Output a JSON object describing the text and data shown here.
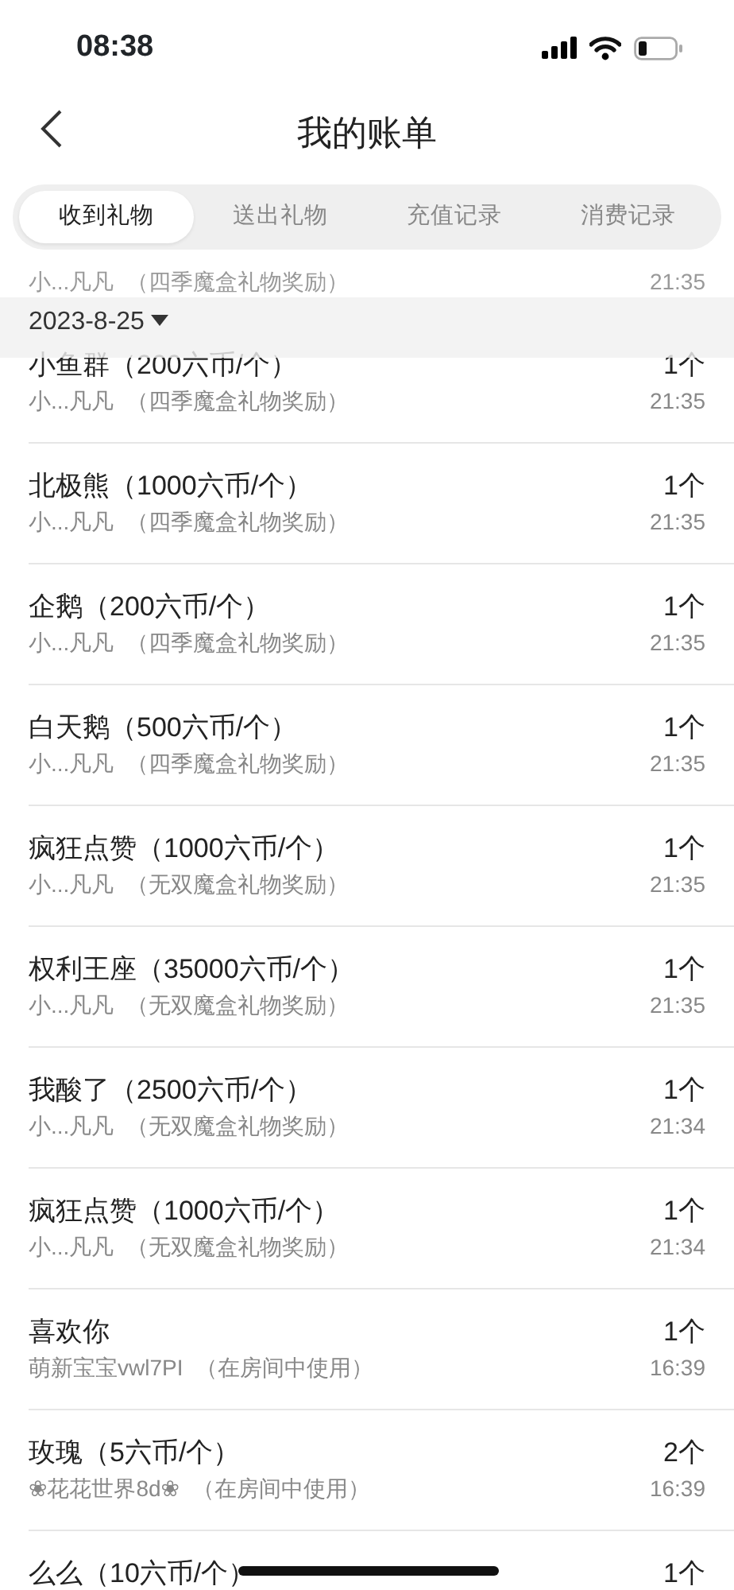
{
  "status_bar": {
    "time": "08:38"
  },
  "header": {
    "title": "我的账单"
  },
  "tabs": [
    {
      "label": "收到礼物",
      "selected": true
    },
    {
      "label": "送出礼物",
      "selected": false
    },
    {
      "label": "充值记录",
      "selected": false
    },
    {
      "label": "消费记录",
      "selected": false
    }
  ],
  "date_header": {
    "date": "2023-8-25",
    "expanded": true
  },
  "records": [
    {
      "kind": "partial",
      "sender": "小...凡凡",
      "source": "（四季魔盒礼物奖励）",
      "time": "21:35"
    },
    {
      "kind": "full",
      "gift": "小鱼群（200六币/个）",
      "count": "1个",
      "sender": "小...凡凡",
      "source": "（四季魔盒礼物奖励）",
      "time": "21:35"
    },
    {
      "kind": "full",
      "gift": "北极熊（1000六币/个）",
      "count": "1个",
      "sender": "小...凡凡",
      "source": "（四季魔盒礼物奖励）",
      "time": "21:35"
    },
    {
      "kind": "full",
      "gift": "企鹅（200六币/个）",
      "count": "1个",
      "sender": "小...凡凡",
      "source": "（四季魔盒礼物奖励）",
      "time": "21:35"
    },
    {
      "kind": "full",
      "gift": "白天鹅（500六币/个）",
      "count": "1个",
      "sender": "小...凡凡",
      "source": "（四季魔盒礼物奖励）",
      "time": "21:35"
    },
    {
      "kind": "full",
      "gift": "疯狂点赞（1000六币/个）",
      "count": "1个",
      "sender": "小...凡凡",
      "source": "（无双魔盒礼物奖励）",
      "time": "21:35"
    },
    {
      "kind": "full",
      "gift": "权利王座（35000六币/个）",
      "count": "1个",
      "sender": "小...凡凡",
      "source": "（无双魔盒礼物奖励）",
      "time": "21:35"
    },
    {
      "kind": "full",
      "gift": "我酸了（2500六币/个）",
      "count": "1个",
      "sender": "小...凡凡",
      "source": "（无双魔盒礼物奖励）",
      "time": "21:34"
    },
    {
      "kind": "full",
      "gift": "疯狂点赞（1000六币/个）",
      "count": "1个",
      "sender": "小...凡凡",
      "source": "（无双魔盒礼物奖励）",
      "time": "21:34"
    },
    {
      "kind": "full",
      "gift": "喜欢你",
      "count": "1个",
      "sender": "萌新宝宝vwl7PI",
      "source": "（在房间中使用）",
      "time": "16:39"
    },
    {
      "kind": "full",
      "gift": "玫瑰（5六币/个）",
      "count": "2个",
      "sender": "❀花花世界8d❀",
      "source": "（在房间中使用）",
      "time": "16:39"
    },
    {
      "kind": "full",
      "gift": "么么（10六币/个）",
      "count": "1个"
    }
  ]
}
